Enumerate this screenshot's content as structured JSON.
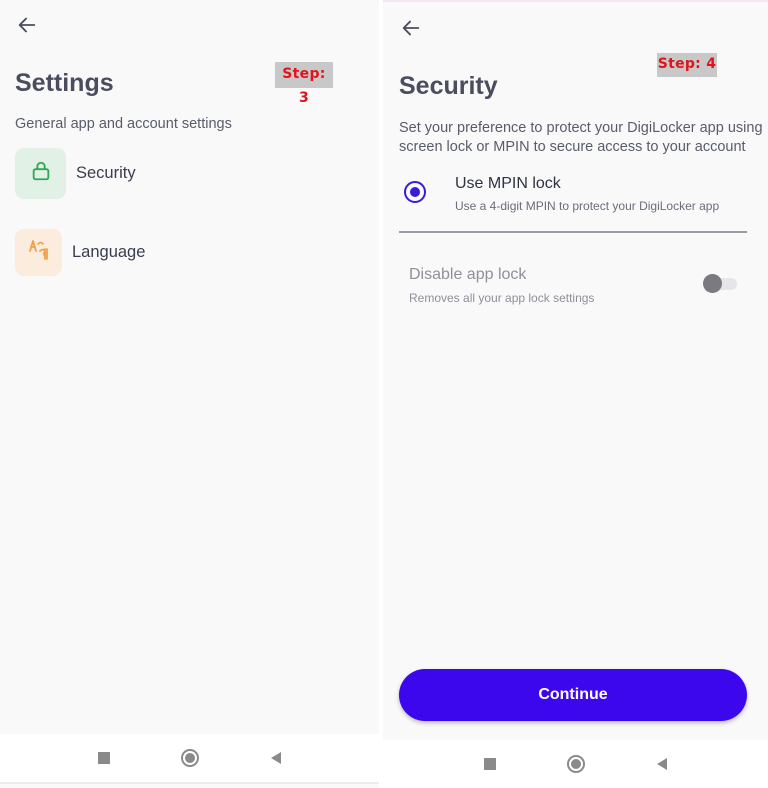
{
  "step3": {
    "badge": "Step: 3",
    "title": "Settings",
    "subtitle": "General app and account settings",
    "items": [
      {
        "label": "Security",
        "icon": "lock-icon"
      },
      {
        "label": "Language",
        "icon": "language-icon"
      }
    ]
  },
  "step4": {
    "badge": "Step: 4",
    "title": "Security",
    "subtitle_line1": "Set your preference to protect your DigiLocker app using",
    "subtitle_line2": "screen lock or MPIN to secure access to your account",
    "mpin": {
      "title": "Use MPIN lock",
      "desc": "Use a 4-digit MPIN to protect your DigiLocker app",
      "selected": true
    },
    "disable": {
      "title": "Disable app lock",
      "desc": "Removes all your app lock settings",
      "enabled": false
    },
    "continue_label": "Continue"
  },
  "colors": {
    "accent": "#3d07ee",
    "radio": "#3b1bd6",
    "badge_text": "#e0141b",
    "security_icon": "#2fa84f",
    "language_icon": "#f0a04b"
  },
  "nav": [
    "recents-icon",
    "home-icon",
    "back-icon"
  ]
}
